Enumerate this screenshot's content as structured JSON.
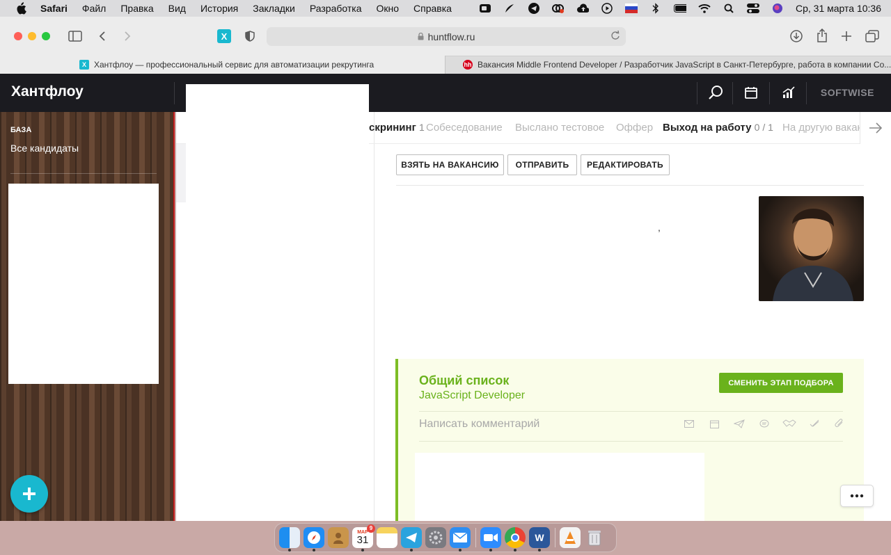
{
  "menubar": {
    "app": "Safari",
    "items": [
      "Файл",
      "Правка",
      "Вид",
      "История",
      "Закладки",
      "Разработка",
      "Окно",
      "Справка"
    ],
    "clock": "Ср, 31 марта  10:36"
  },
  "browser": {
    "url": "huntflow.ru",
    "tabs": [
      {
        "title": "Хантфлоу — профессиональный сервис для автоматизации рекрутинга"
      },
      {
        "title": "Вакансия Middle Frontend Developer / Разработчик JavaScript в Санкт-Петербурге, работа в компании Co..."
      }
    ]
  },
  "app": {
    "logo": "Хантфлоу",
    "company": "SOFTWISE"
  },
  "sidebar": {
    "section": "БАЗА",
    "link": "Все кандидаты"
  },
  "stages": [
    {
      "label": "скрининг",
      "count": "1",
      "style": "dark"
    },
    {
      "label": "Собеседование",
      "count": "",
      "style": "muted"
    },
    {
      "label": "Выслано тестовое",
      "count": "",
      "style": "muted"
    },
    {
      "label": "Оффер",
      "count": "",
      "style": "muted"
    },
    {
      "label": "Выход на работу",
      "count": "0 / 1",
      "style": "dark"
    },
    {
      "label": "На другую вакан",
      "count": "",
      "style": "muted"
    }
  ],
  "actions": {
    "take": "ВЗЯТЬ НА ВАКАНСИЮ",
    "send": "ОТПРАВИТЬ",
    "edit": "РЕДАКТИРОВАТЬ"
  },
  "candidate": {
    "comma": ","
  },
  "funnel": {
    "title": "Общий список",
    "vacancy": "JavaScript Developer",
    "change_stage": "СМЕНИТЬ ЭТАП ПОДБОРА",
    "comment_placeholder": "Написать комментарий"
  },
  "dock": {
    "calendar_month": "МАР",
    "calendar_day": "31",
    "calendar_badge": "9"
  },
  "colors": {
    "accent_green": "#6ab21c",
    "fab_cyan": "#19b8cf",
    "header_dark": "#1b1b20"
  }
}
